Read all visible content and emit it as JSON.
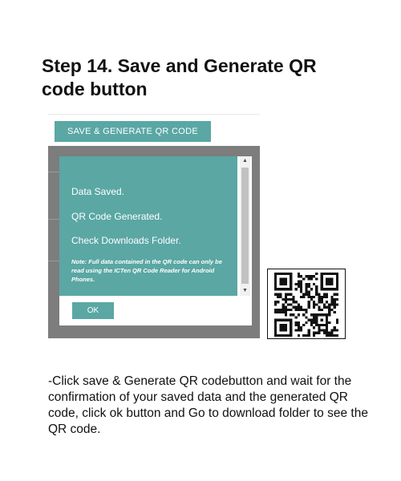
{
  "step": {
    "title_line1": "Step 14. Save and Generate QR",
    "title_line2": "code button"
  },
  "app": {
    "save_button_label": "SAVE & GENERATE QR CODE",
    "dialog": {
      "messages": [
        "Data Saved.",
        "QR Code Generated.",
        "Check Downloads Folder."
      ],
      "note": "Note: Full data contained in the QR code can only be read using the ICTen QR Code Reader for Android Phones.",
      "ok_label": "OK"
    },
    "colors": {
      "accent": "#5aa7a4",
      "overlay": "#7d7d7d"
    }
  },
  "qr": {
    "icon": "qr-code-icon"
  },
  "description": "-Click save & Generate QR codebutton and wait for the confirmation of your saved data and the generated QR code, click ok button and  Go to download folder to see the QR code."
}
